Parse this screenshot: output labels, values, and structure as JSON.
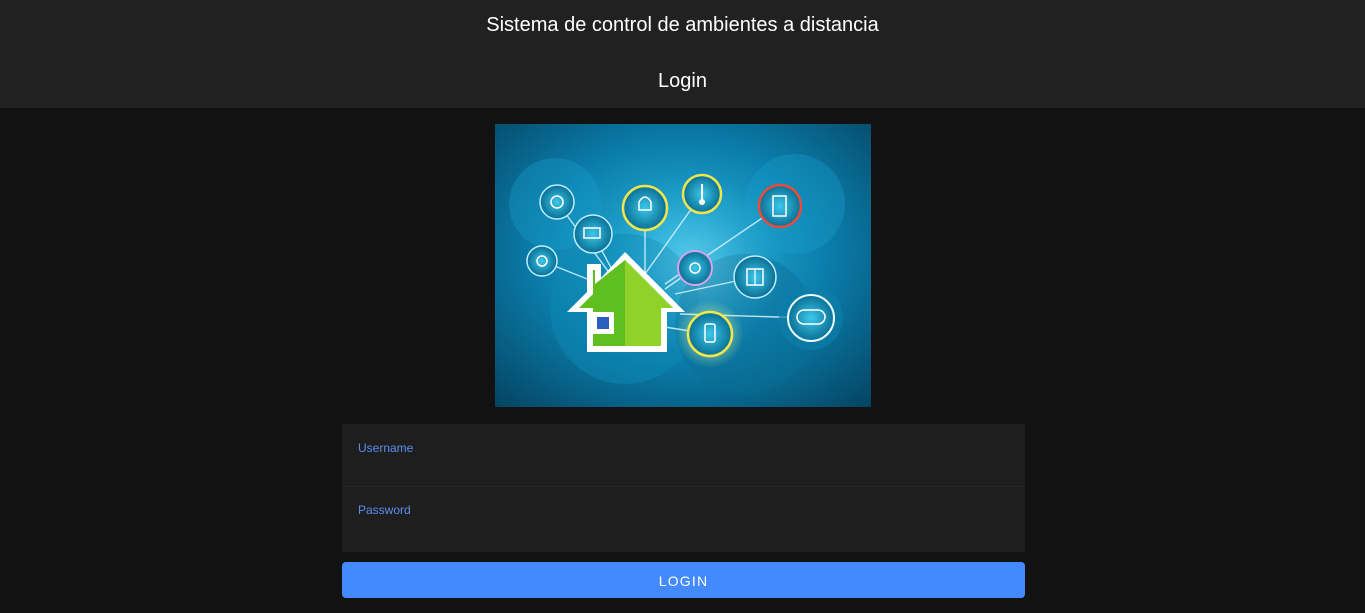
{
  "header": {
    "app_title": "Sistema de control de ambientes a distancia",
    "page_title": "Login"
  },
  "hero": {
    "description_icons": [
      "smart-home-icon",
      "light-bulb-icon",
      "thermometer-icon",
      "door-icon",
      "camera-icon",
      "fan-icon",
      "wifi-icon",
      "window-icon",
      "gate-icon",
      "remote-icon",
      "speaker-icon"
    ]
  },
  "form": {
    "username_label": "Username",
    "username_value": "",
    "password_label": "Password",
    "password_value": "",
    "submit_label": "LOGIN"
  },
  "colors": {
    "header_bg": "#212121",
    "page_bg": "#121212",
    "accent": "#448aff",
    "label": "#5b8ef0"
  }
}
